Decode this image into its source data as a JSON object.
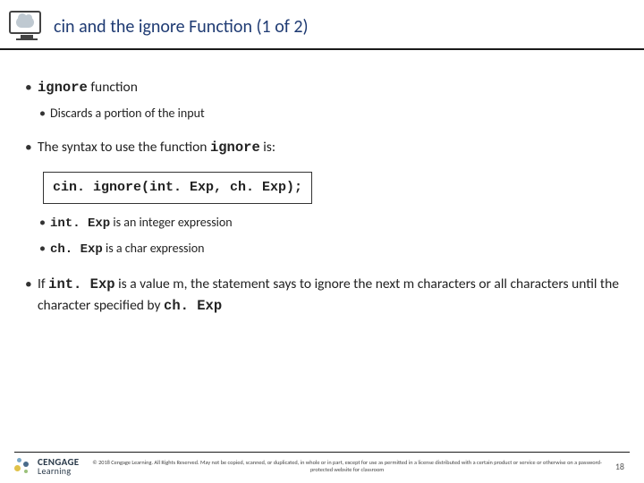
{
  "header": {
    "title": "cin and the ignore Function (1 of 2)"
  },
  "content": {
    "b1_code": "ignore",
    "b1_rest": " function",
    "b1_sub1": "Discards a portion of the input",
    "b2_pre": "The syntax to use the function ",
    "b2_code": "ignore",
    "b2_post": " is:",
    "codebox": "cin. ignore(int. Exp, ch. Exp);",
    "b2_sub1_code": "int. Exp",
    "b2_sub1_rest": " is an integer expression",
    "b2_sub2_code": "ch. Exp",
    "b2_sub2_rest": " is a char expression",
    "b3_pre": "If ",
    "b3_code1": "int. Exp",
    "b3_mid": " is a value m, the statement says to ignore the next m characters or all characters until the character specified by ",
    "b3_code2": "ch. Exp"
  },
  "footer": {
    "brand_top": "CENGAGE",
    "brand_bottom": "Learning",
    "copyright": "© 2018 Cengage Learning. All Rights Reserved. May not be copied, scanned, or duplicated, in whole or in part, except for use as permitted in a license distributed with a certain product or service or otherwise on a password-protected website for classroom",
    "page": "18"
  }
}
